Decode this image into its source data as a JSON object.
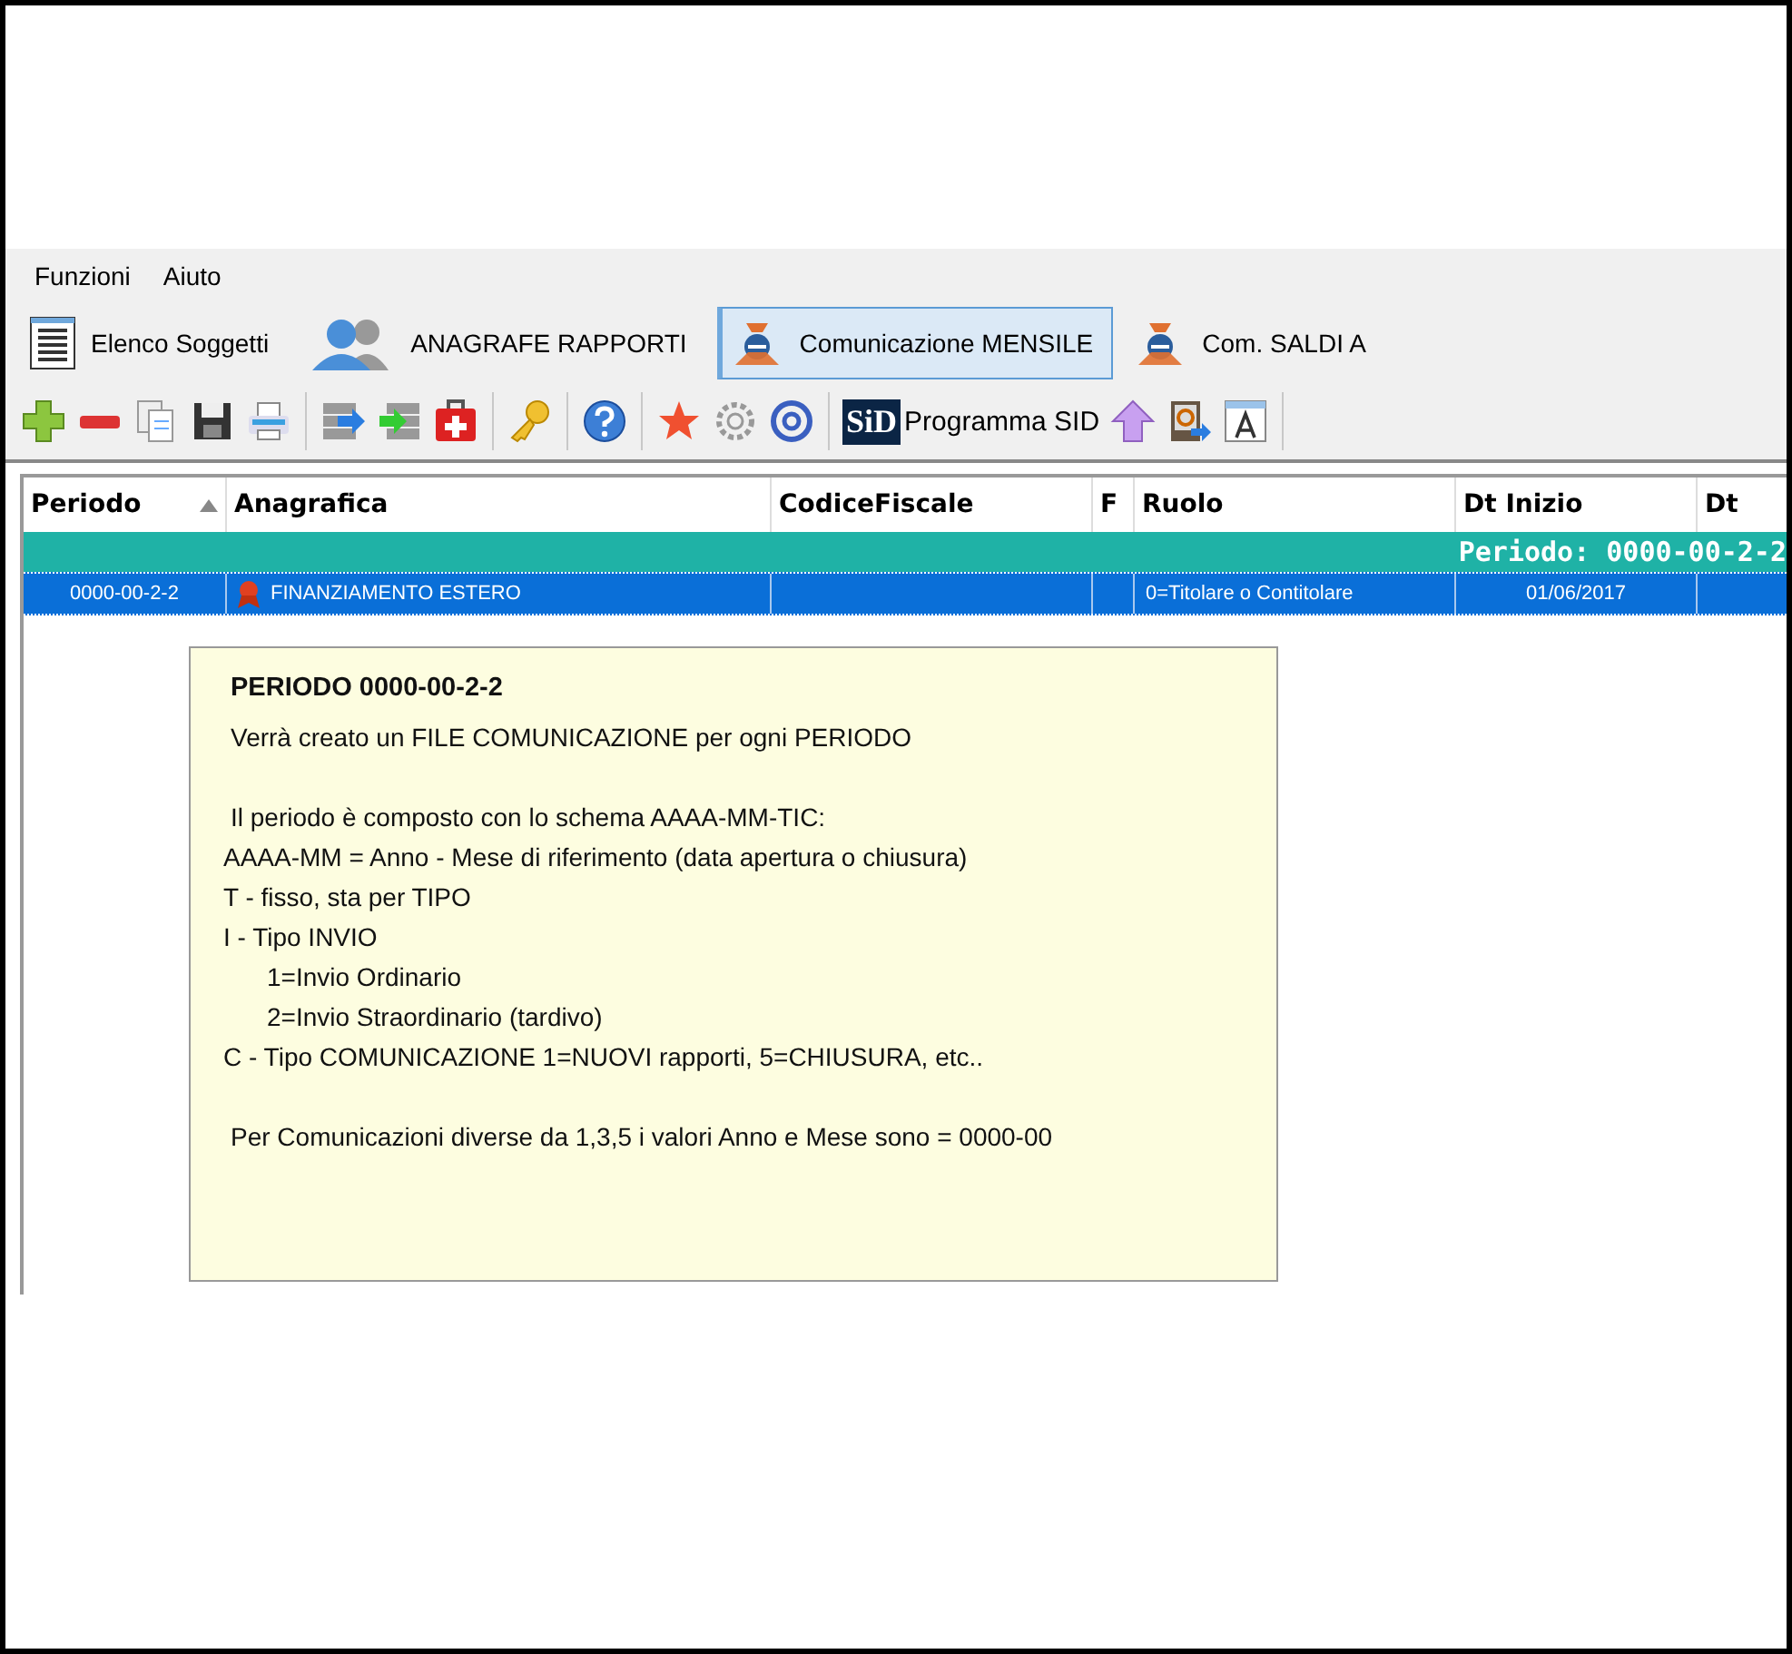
{
  "menu": [
    {
      "label": "Funzioni"
    },
    {
      "label": "Aiuto"
    }
  ],
  "tabs": [
    {
      "label": "Elenco Soggetti",
      "kind": "list",
      "selected": false
    },
    {
      "label": "ANAGRAFE RAPPORTI",
      "kind": "people",
      "selected": false
    },
    {
      "label": "Comunicazione MENSILE",
      "kind": "agency",
      "selected": true
    },
    {
      "label": "Com. SALDI A",
      "kind": "agency",
      "selected": false
    }
  ],
  "toolbar": {
    "sid_button": {
      "badge": "SiD",
      "label": "Programma SID"
    }
  },
  "table": {
    "columns": [
      {
        "label": "Periodo",
        "sorted": true
      },
      {
        "label": "Anagrafica",
        "sorted": false
      },
      {
        "label": "CodiceFiscale",
        "sorted": false
      },
      {
        "label": "F",
        "sorted": false
      },
      {
        "label": "Ruolo",
        "sorted": false
      },
      {
        "label": "Dt Inizio",
        "sorted": false
      },
      {
        "label": "Dt",
        "sorted": false
      }
    ],
    "group": {
      "label": "Periodo: 0000-00-2-2"
    },
    "rows": [
      {
        "periodo": "0000-00-2-2",
        "anagrafica": "FINANZIAMENTO ESTERO",
        "ruolo": "0=Titolare o Contitolare",
        "dt_inizio": "01/06/2017",
        "selected": true
      }
    ]
  },
  "tooltip": {
    "title": "PERIODO 0000-00-2-2",
    "paragraphs": [
      {
        "lines": [
          {
            "text": "Verrà creato un FILE COMUNICAZIONE per ogni PERIODO",
            "kind": "note"
          }
        ]
      },
      {
        "lines": [
          {
            "text": "Il periodo è composto con lo schema AAAA-MM-TIC:",
            "kind": "note"
          },
          {
            "text": "AAAA-MM = Anno - Mese di riferimento (data apertura o chiusura)",
            "kind": "line"
          },
          {
            "text": "T - fisso, sta per TIPO",
            "kind": "line"
          },
          {
            "text": "I - Tipo INVIO",
            "kind": "line"
          },
          {
            "text": "1=Invio Ordinario",
            "kind": "sub"
          },
          {
            "text": "2=Invio Straordinario (tardivo)",
            "kind": "sub"
          },
          {
            "text": "C - Tipo COMUNICAZIONE 1=NUOVI rapporti, 5=CHIUSURA,  etc..",
            "kind": "line"
          }
        ]
      },
      {
        "lines": [
          {
            "text": "Per Comunicazioni diverse da 1,3,5 i valori Anno e Mese sono = 0000-00",
            "kind": "note"
          }
        ]
      }
    ]
  }
}
